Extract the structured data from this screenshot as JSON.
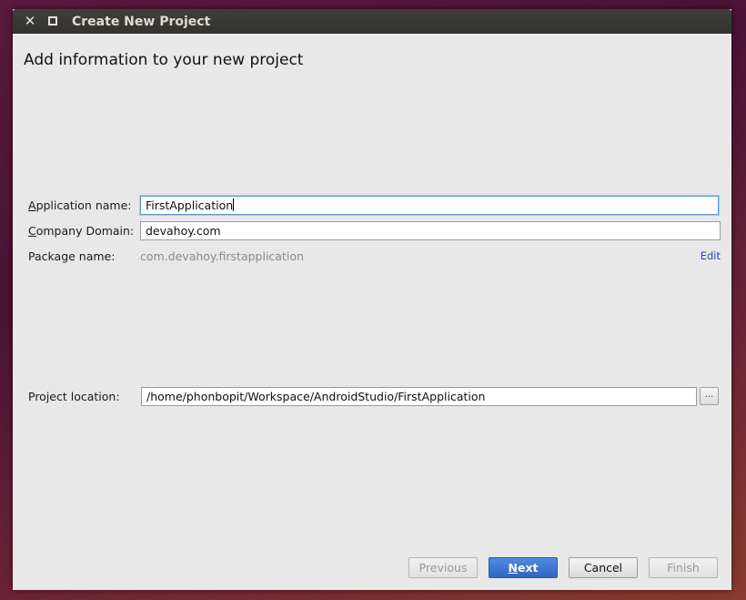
{
  "window": {
    "title": "Create New Project",
    "close_glyph": "✕",
    "maximize_glyph": ""
  },
  "heading": "Add information to your new project",
  "form": {
    "application_name": {
      "label_mnemonic": "A",
      "label_rest": "pplication name:",
      "value": "FirstApplication"
    },
    "company_domain": {
      "label_mnemonic": "C",
      "label_rest": "ompany Domain:",
      "value": "devahoy.com"
    },
    "package_name": {
      "label": "Package name:",
      "value": "com.devahoy.firstapplication",
      "edit_label": "Edit"
    },
    "project_location": {
      "label": "Project location:",
      "value": "/home/phonbopit/Workspace/AndroidStudio/FirstApplication",
      "browse_label": "..."
    }
  },
  "buttons": {
    "previous": "Previous",
    "next_mnemonic": "N",
    "next_rest": "ext",
    "cancel": "Cancel",
    "finish": "Finish"
  },
  "colors": {
    "accent": "#3a72d0",
    "focus_ring": "#5b95d6",
    "link": "#2a40b8"
  },
  "icons": {
    "close": "close-icon",
    "maximize": "maximize-icon"
  }
}
